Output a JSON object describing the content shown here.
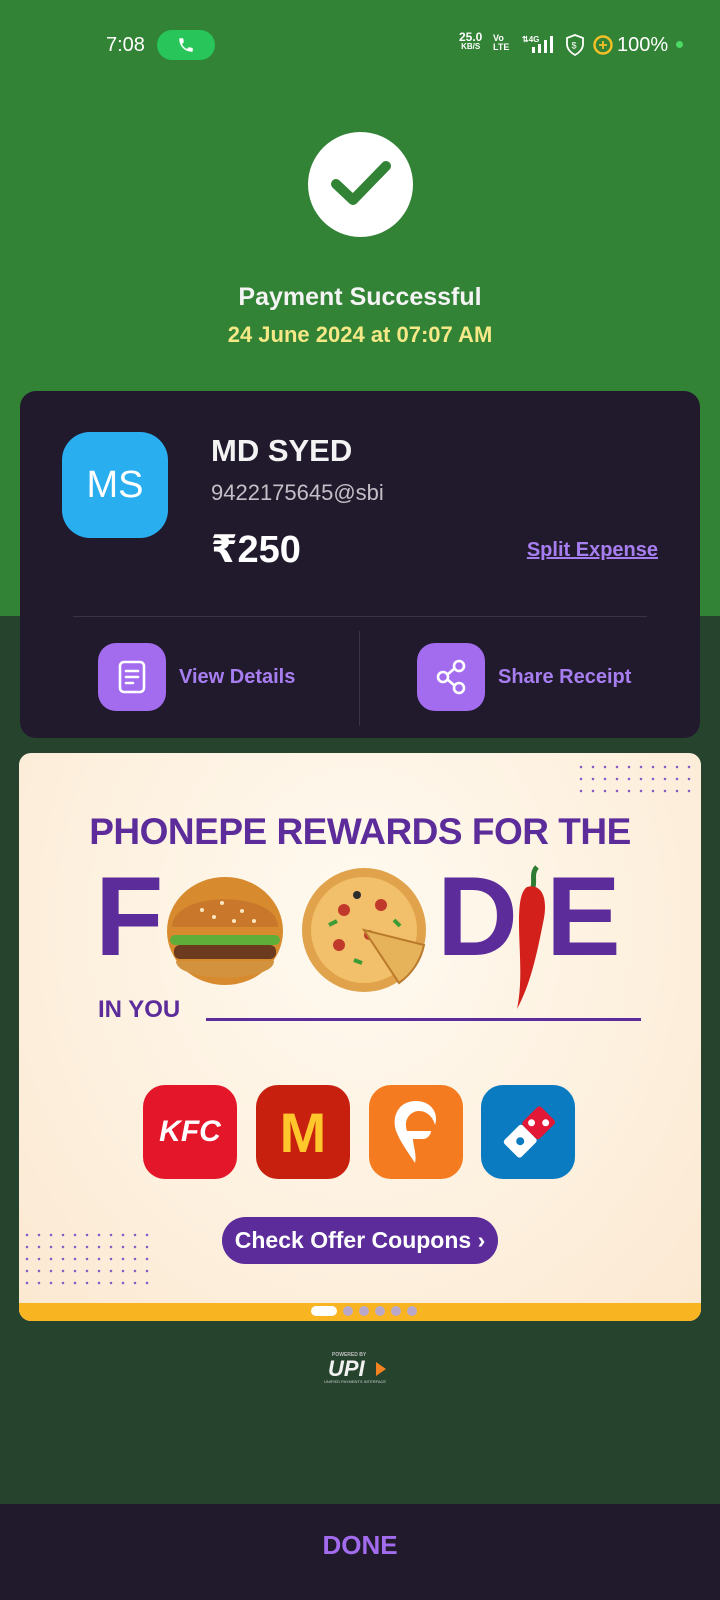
{
  "status_bar": {
    "time": "7:08",
    "net_speed": "25.0",
    "net_speed_unit": "KB/S",
    "volte": "Vo LTE",
    "network": "4G",
    "battery": "100%"
  },
  "header": {
    "title": "Payment Successful",
    "datetime": "24 June 2024 at 07:07 AM"
  },
  "payee": {
    "initials": "MS",
    "name": "MD SYED",
    "upi_id": "9422175645@sbi",
    "amount": "₹250",
    "split_label": "Split Expense",
    "view_details_label": "View Details",
    "share_receipt_label": "Share Receipt"
  },
  "banner": {
    "headline": "PHONEPE REWARDS FOR THE",
    "word_f": "F",
    "word_d": "D",
    "word_e": "E",
    "subline": "IN YOU",
    "brands": [
      "KFC",
      "M",
      "swiggy",
      "domino's"
    ],
    "cta": "Check Offer Coupons ›",
    "pager": {
      "count": 6,
      "active": 0
    }
  },
  "upi_logo": {
    "powered_by": "POWERED BY",
    "mark": "UPI",
    "subtitle": "UNIFIED PAYMENTS INTERFACE"
  },
  "footer": {
    "done_label": "DONE"
  },
  "colors": {
    "success_green": "#328335",
    "card_bg": "#211a2d",
    "accent_purple": "#a36cee",
    "date_yellow": "#f5e887",
    "avatar_blue": "#29aef0"
  }
}
